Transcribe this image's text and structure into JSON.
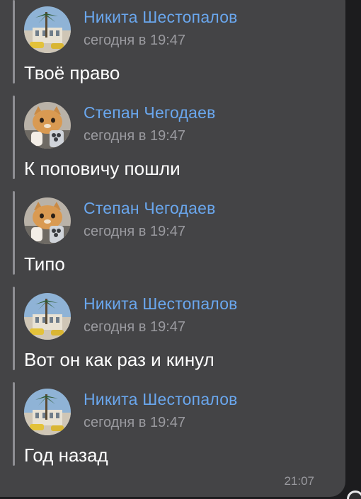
{
  "messages": [
    {
      "author": "Никита Шестопалов",
      "time": "сегодня в 19:47",
      "text": "Твоё право",
      "avatar": "palm-building-avatar-icon"
    },
    {
      "author": "Степан Чегодаев",
      "time": "сегодня в 19:47",
      "text": "К поповичу пошли",
      "avatar": "cat-phone-avatar-icon"
    },
    {
      "author": "Степан Чегодаев",
      "time": "сегодня в 19:47",
      "text": "Типо",
      "avatar": "cat-phone-avatar-icon"
    },
    {
      "author": "Никита Шестопалов",
      "time": "сегодня в 19:47",
      "text": "Вот он как раз и кинул",
      "avatar": "palm-building-avatar-icon"
    },
    {
      "author": "Никита Шестопалов",
      "time": "сегодня в 19:47",
      "text": "Год назад",
      "avatar": "palm-building-avatar-icon"
    }
  ],
  "sent_time": "21:07",
  "colors": {
    "background": "#1c1c1e",
    "bubble": "#444446",
    "author": "#6aa7ee",
    "secondary": "#9a9a9f",
    "text": "#ffffff"
  }
}
